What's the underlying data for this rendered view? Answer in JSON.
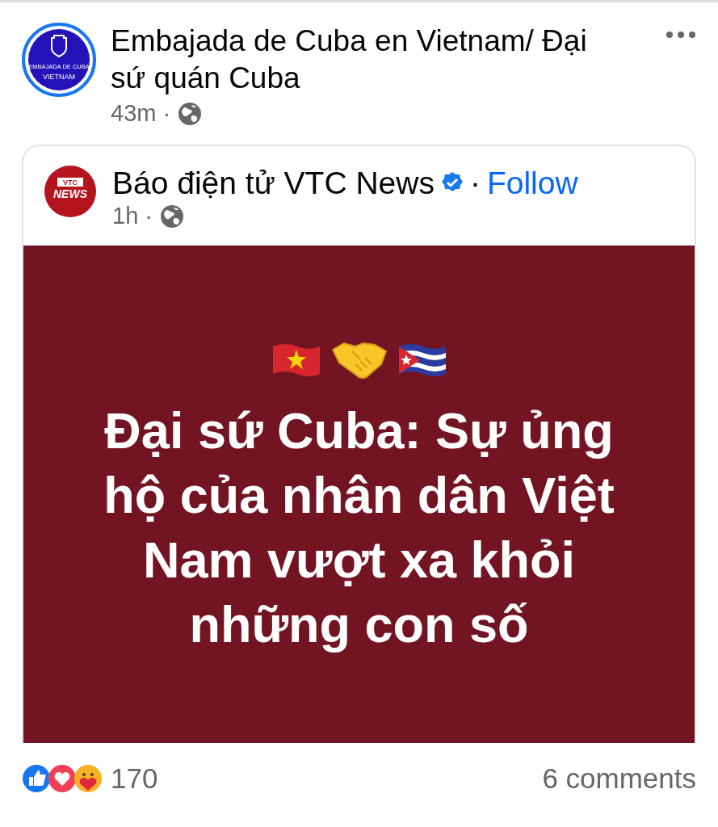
{
  "post": {
    "author": "Embajada de Cuba en Vietnam/ Đại sứ quán Cuba",
    "avatar_text": [
      "EMBAJADA DE CUBA",
      "VIETNAM"
    ],
    "time": "43m",
    "separator": "·"
  },
  "shared": {
    "author": "Báo điện tử VTC News",
    "verified": true,
    "separator": "·",
    "follow": "Follow",
    "avatar_text": [
      "VTC",
      "NEWS"
    ],
    "time": "1h",
    "time_separator": "·",
    "headline": "Đại sứ Cuba: Sự ủng hộ của nhân dân Việt Nam vượt xa khỏi những con số"
  },
  "footer": {
    "reactions": "170",
    "comments": "6 comments"
  }
}
